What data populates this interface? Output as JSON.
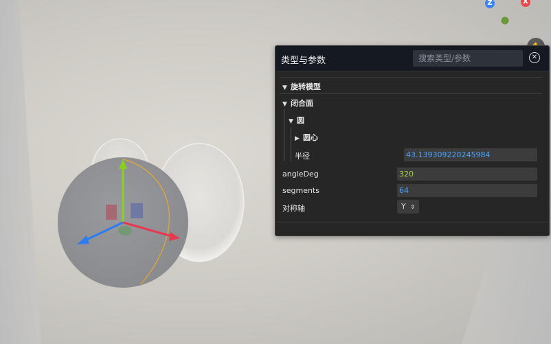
{
  "axis_gizmo": {
    "z_label": "Z",
    "x_label": "X",
    "colors": {
      "z": "#3b82f6",
      "x": "#e5484d",
      "y": "#6a9a3a"
    }
  },
  "panel": {
    "title": "类型与参数",
    "search_placeholder": "搜索类型/参数",
    "close_icon": "circle-x-icon",
    "sections": {
      "rotate_model": "旋转模型",
      "closed_surface": "闭合面",
      "circle": "圆",
      "center": "圆心"
    },
    "fields": {
      "radius_label": "半径",
      "radius_value": "43.139309220245984",
      "angle_label": "angleDeg",
      "angle_value": "320",
      "segments_label": "segments",
      "segments_value": "64",
      "axis_label": "对称轴",
      "axis_value": "Y"
    }
  }
}
